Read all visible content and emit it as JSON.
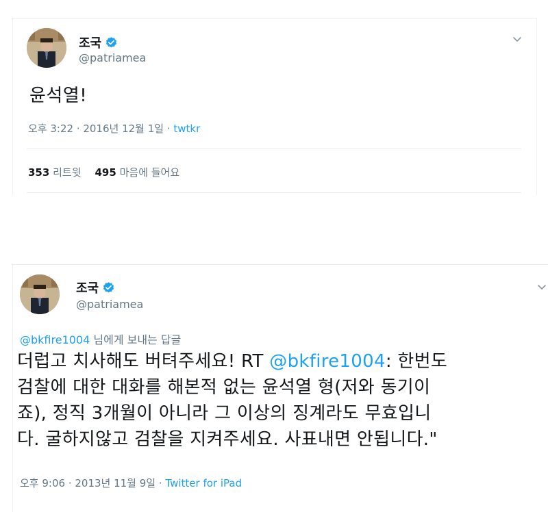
{
  "tweet1": {
    "author_name": "조국",
    "handle": "@patriamea",
    "text": "윤석열!",
    "timestamp": "오후 3:22 · 2016년 12월 1일 · ",
    "source": "twtkr",
    "retweets_count": "353",
    "retweets_label": "리트윗",
    "likes_count": "495",
    "likes_label": "마음에 들어요"
  },
  "tweet2": {
    "author_name": "조국",
    "handle": "@patriamea",
    "reply_to_mention": "@bkfire1004",
    "reply_to_suffix": " 님에게 보내는 답글",
    "line1_before": "더럽고 치사해도 버텨주세요! RT ",
    "line1_mention": "@bkfire1004",
    "line1_after": ": 한번도",
    "line2": "검찰에 대한 대화를 해본적 없는 윤석열 형(저와 동기이",
    "line3": "죠), 정직 3개월이 아니라 그 이상의 징계라도 무효입니",
    "line4": "다. 굴하지않고 검찰을 지켜주세요. 사표내면 안됩니다.\"",
    "timestamp": "오후 9:06 · 2013년 11월 9일 · ",
    "source": "Twitter for iPad"
  },
  "icons": {
    "verified": "verified-badge-icon",
    "caret": "chevron-down-icon"
  },
  "colors": {
    "link": "#1da1f2",
    "secondary_text": "#657786",
    "primary_text": "#14171a",
    "divider": "#e6ecf0"
  }
}
